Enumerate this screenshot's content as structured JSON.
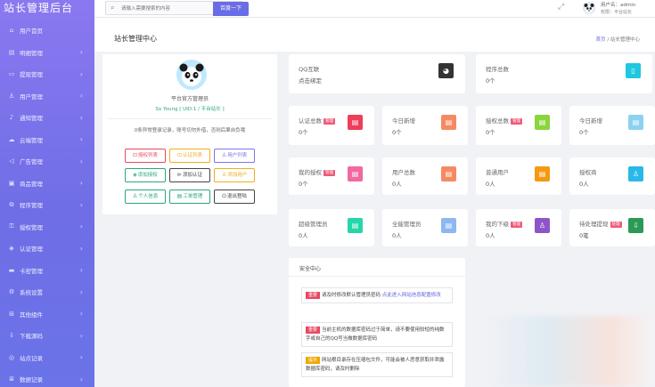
{
  "app": {
    "title": "站长管理后台"
  },
  "sidebar": {
    "items": [
      {
        "label": "用户首页",
        "icon": "home-icon",
        "glyph": "⌂"
      },
      {
        "label": "明细管理",
        "icon": "list-icon",
        "glyph": "▤"
      },
      {
        "label": "提现管理",
        "icon": "cash-icon",
        "glyph": "▭"
      },
      {
        "label": "用户管理",
        "icon": "user-icon",
        "glyph": "♙"
      },
      {
        "label": "通知管理",
        "icon": "bell-icon",
        "glyph": "♪"
      },
      {
        "label": "云端管理",
        "icon": "cloud-icon",
        "glyph": "☁"
      },
      {
        "label": "广告管理",
        "icon": "megaphone-icon",
        "glyph": "◁"
      },
      {
        "label": "商品管理",
        "icon": "box-icon",
        "glyph": "▣"
      },
      {
        "label": "程序管理",
        "icon": "code-icon",
        "glyph": "⧉"
      },
      {
        "label": "授权管理",
        "icon": "key-icon",
        "glyph": "⚿"
      },
      {
        "label": "认证管理",
        "icon": "shield-icon",
        "glyph": "◈"
      },
      {
        "label": "卡密管理",
        "icon": "card-icon",
        "glyph": "▬"
      },
      {
        "label": "系统设置",
        "icon": "gear-icon",
        "glyph": "⚙"
      },
      {
        "label": "其他组件",
        "icon": "grid-icon",
        "glyph": "⊞"
      },
      {
        "label": "下载源码",
        "icon": "download-icon",
        "glyph": "⇩"
      },
      {
        "label": "站点记录",
        "icon": "record-icon",
        "glyph": "◎"
      },
      {
        "label": "数据记录",
        "icon": "database-icon",
        "glyph": "≣"
      }
    ]
  },
  "topbar": {
    "search_placeholder": "请输入需要搜索的内容",
    "search_button": "百度一下",
    "user_name": "用户名：admin",
    "user_role": "权限：平台站长"
  },
  "page": {
    "title": "站长管理中心",
    "breadcrumb_home": "首页",
    "breadcrumb_sep": " / ",
    "breadcrumb_current": "站长管理中心"
  },
  "profile": {
    "role": "平台官方管理员",
    "name": "So Young [ UID:1 / 平台站长 ]",
    "warning": "0条异常登录记录，账号切勿外借，否则后果自负哦",
    "buttons": [
      {
        "label": "授权列表",
        "icon": "tag-icon",
        "glyph": "⊡",
        "color": "#e8475f"
      },
      {
        "label": "认证列表",
        "icon": "badge-icon",
        "glyph": "⊡",
        "color": "#f0ad1e"
      },
      {
        "label": "用户列表",
        "icon": "user-icon",
        "glyph": "♙",
        "color": "#7b74e8"
      },
      {
        "label": "添加授权",
        "icon": "shield-icon",
        "glyph": "◈",
        "color": "#27a97a"
      },
      {
        "label": "添加认证",
        "icon": "play-icon",
        "glyph": "⊳",
        "color": "#444444"
      },
      {
        "label": "添加用户",
        "icon": "user-add-icon",
        "glyph": "♙",
        "color": "#f0ad1e"
      },
      {
        "label": "个人信息",
        "icon": "person-icon",
        "glyph": "♙",
        "color": "#27a97a"
      },
      {
        "label": "工单管理",
        "icon": "ticket-icon",
        "glyph": "▤",
        "color": "#27a97a"
      },
      {
        "label": "退出登陆",
        "icon": "power-icon",
        "glyph": "⏻",
        "color": "#444444"
      }
    ]
  },
  "cards": [
    {
      "title": "QQ互联",
      "value": "点击绑定",
      "badge": "",
      "icon": "qq-icon",
      "glyph": "◕",
      "color": "#333333"
    },
    {
      "title": "程序总数",
      "value": "0个",
      "badge": "",
      "icon": "phone-icon",
      "glyph": "▯",
      "color": "#1fc8e0"
    },
    {
      "title": "认证总数",
      "value": "0个",
      "badge": "管理",
      "icon": "doc-icon",
      "glyph": "▤",
      "color": "#ef3d5a"
    },
    {
      "title": "今日新增",
      "value": "0个",
      "badge": "",
      "icon": "doc-icon",
      "glyph": "▤",
      "color": "#f58a62"
    },
    {
      "title": "授权总数",
      "value": "0个",
      "badge": "管理",
      "icon": "doc-icon",
      "glyph": "▤",
      "color": "#8ad53c"
    },
    {
      "title": "今日新增",
      "value": "0个",
      "badge": "",
      "icon": "doc-icon",
      "glyph": "▤",
      "color": "#8bd2f2"
    },
    {
      "title": "我的授权",
      "value": "0个",
      "badge": "管理",
      "icon": "doc-icon",
      "glyph": "▤",
      "color": "#f069a0"
    },
    {
      "title": "用户总数",
      "value": "0人",
      "badge": "",
      "icon": "doc-icon",
      "glyph": "▤",
      "color": "#f58a62"
    },
    {
      "title": "普通用户",
      "value": "0人",
      "badge": "",
      "icon": "doc-icon",
      "glyph": "▤",
      "color": "#f59a10"
    },
    {
      "title": "授权商",
      "value": "0人",
      "badge": "",
      "icon": "user-icon",
      "glyph": "♙",
      "color": "#29b8e8"
    },
    {
      "title": "超级管理员",
      "value": "0人",
      "badge": "",
      "icon": "doc-icon",
      "glyph": "▤",
      "color": "#25d6a8"
    },
    {
      "title": "全能管理员",
      "value": "0人",
      "badge": "",
      "icon": "doc-icon",
      "glyph": "▤",
      "color": "#8db7f0"
    },
    {
      "title": "我的下级",
      "value": "0人",
      "badge": "管理",
      "icon": "user-icon",
      "glyph": "♙",
      "color": "#8e55c8"
    },
    {
      "title": "待处理提现",
      "value": "0笔",
      "badge": "处理",
      "icon": "download-icon",
      "glyph": "⇩",
      "color": "#2b9a54"
    }
  ],
  "security": {
    "title": "安全中心",
    "notices": [
      {
        "tag": "重要",
        "tag_color": "#e8475f",
        "text": "请及时修改默认管理员密码",
        "link": "点此进入网站信息配置修改"
      },
      {
        "tag": "重要",
        "tag_color": "#e8475f",
        "text": "当前主机的数据库密码过于简单，请不要使用较短的纯数字或自己的QQ号当做数据库密码",
        "link": ""
      },
      {
        "tag": "提示",
        "tag_color": "#f0a700",
        "text": "网站根目录存在压缩包文件，可能会被人恶意获取并泄露数据库密码，请及时删除",
        "link": ""
      }
    ]
  }
}
